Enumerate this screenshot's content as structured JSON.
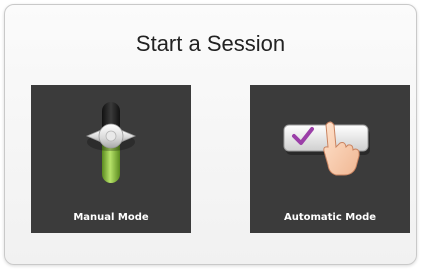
{
  "dialog": {
    "title": "Start a Session"
  },
  "modes": {
    "manual": {
      "label": "Manual Mode",
      "icon": "slider-toggle-icon"
    },
    "automatic": {
      "label": "Automatic Mode",
      "icon": "hand-press-checkmark-button-icon"
    }
  },
  "colors": {
    "tile_background": "#3b3b3b",
    "slider_green": "#8dc63f",
    "check_purple": "#9b3fa8",
    "dialog_border": "#c9c9c9"
  }
}
